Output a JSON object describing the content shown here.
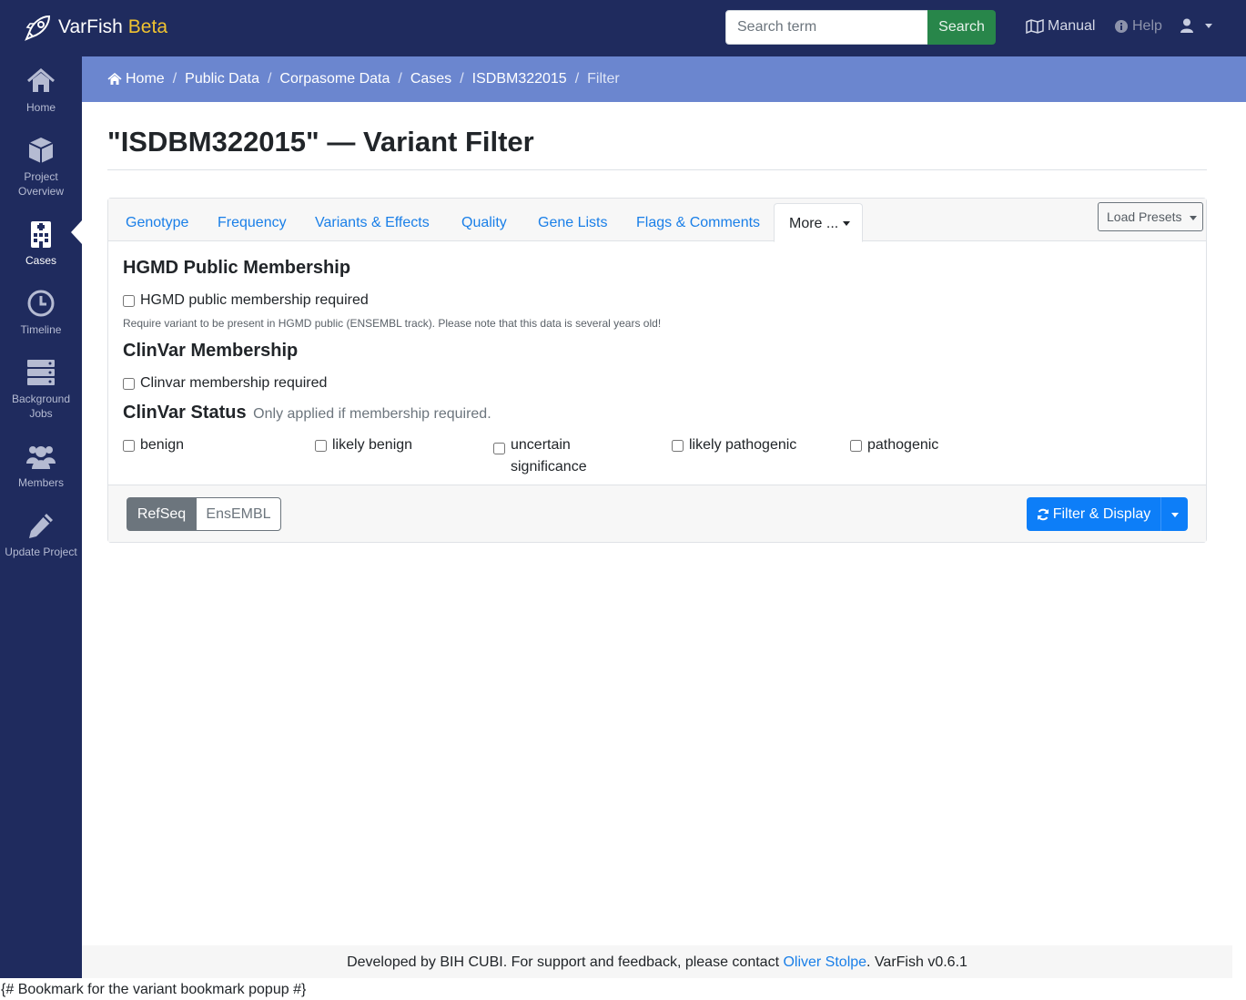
{
  "brand": {
    "name": "VarFish",
    "badge": "Beta",
    "logo_icon": "rocket-icon"
  },
  "search": {
    "placeholder": "Search term",
    "button": "Search"
  },
  "topnav": {
    "manual": "Manual",
    "help": "Help",
    "user_icon": "user-icon"
  },
  "sidebar": {
    "items": [
      {
        "label": "Home",
        "icon": "home-icon"
      },
      {
        "label": "Project Overview",
        "icon": "cube-icon"
      },
      {
        "label": "Cases",
        "icon": "hospital-icon",
        "active": true
      },
      {
        "label": "Timeline",
        "icon": "clock-icon"
      },
      {
        "label": "Background Jobs",
        "icon": "server-icon"
      },
      {
        "label": "Members",
        "icon": "users-icon"
      },
      {
        "label": "Update Project",
        "icon": "pencil-icon"
      }
    ]
  },
  "breadcrumb": [
    "Home",
    "Public Data",
    "Corpasome Data",
    "Cases",
    "ISDBM322015",
    "Filter"
  ],
  "page_title": "\"ISDBM322015\" — Variant Filter",
  "tabs": [
    "Genotype",
    "Frequency",
    "Variants & Effects",
    "Quality",
    "Gene Lists",
    "Flags & Comments",
    "More ..."
  ],
  "load_presets": "Load Presets",
  "hgmd": {
    "heading": "HGMD Public Membership",
    "checkbox": "HGMD public membership required",
    "help": "Require variant to be present in HGMD public (ENSEMBL track). Please note that this data is several years old!"
  },
  "clinvar": {
    "heading": "ClinVar Membership",
    "checkbox": "Clinvar membership required",
    "status_heading": "ClinVar Status",
    "status_note": "Only applied if membership required.",
    "statuses": [
      "benign",
      "likely benign",
      "uncertain significance",
      "likely pathogenic",
      "pathogenic"
    ]
  },
  "footer_buttons": {
    "refseq": "RefSeq",
    "ensembl": "EnsEMBL",
    "filter": "Filter & Display"
  },
  "page_footer": {
    "text_before": "Developed by BIH CUBI. For support and feedback, please contact ",
    "contact": "Oliver Stolpe",
    "text_after": ". VarFish v0.6.1"
  },
  "template_note": "{# Bookmark for the variant bookmark popup #}",
  "colors": {
    "navbar": "#1f2b5e",
    "breadcrumb": "#6b86cf",
    "link": "#1a7fe8",
    "primary": "#0d7ef8",
    "search_button": "#28864a",
    "beta": "#f0c330"
  }
}
